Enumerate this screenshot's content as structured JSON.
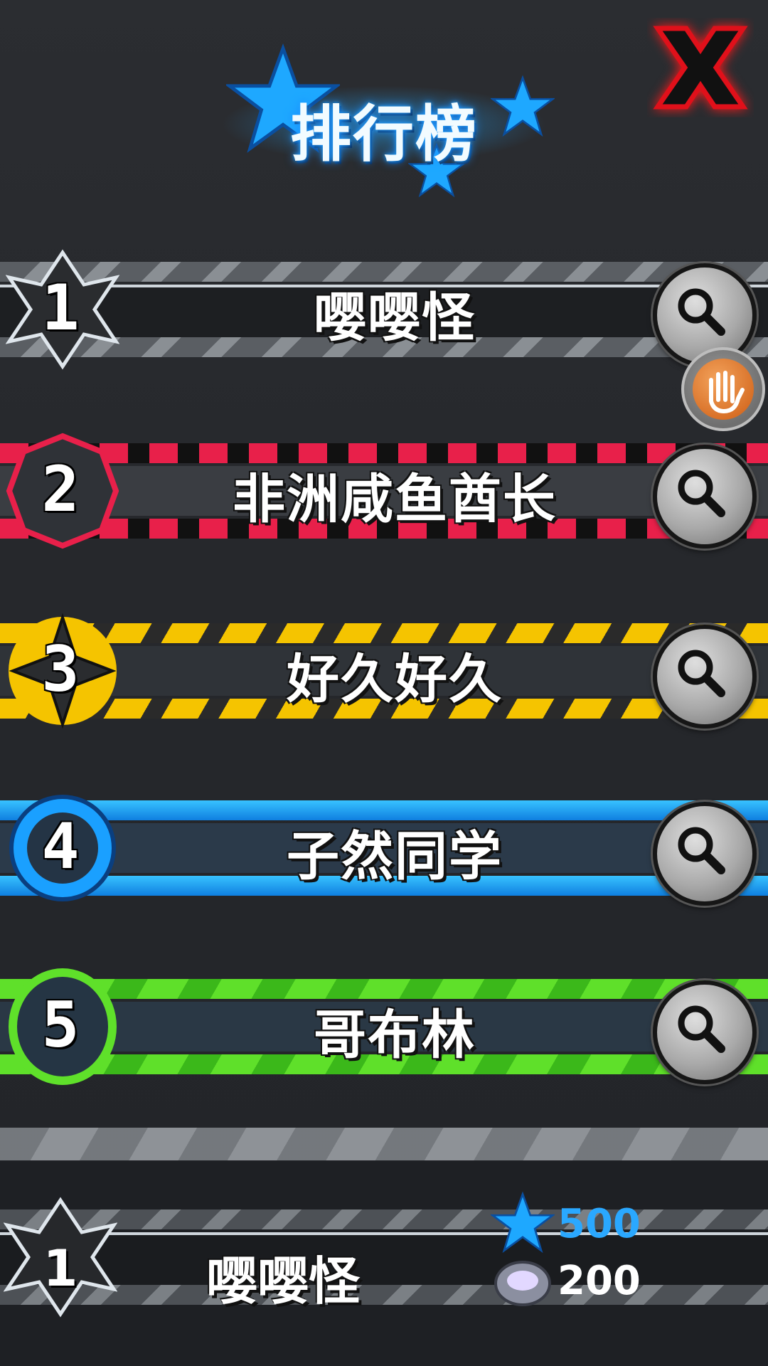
{
  "header": {
    "title": "排行榜",
    "close_icon": "close-x-icon"
  },
  "colors": {
    "rank1": "#9aa0a6",
    "rank2": "#e8204a",
    "rank3": "#f5c400",
    "rank4": "#1aa0ff",
    "rank5": "#5fe02a",
    "title_glow": "#1ea0ff",
    "star_value": "#2aa8ff"
  },
  "leaderboard": [
    {
      "rank": "1",
      "name": "嘤嘤怪",
      "theme": "silver",
      "action_icon": "search-icon"
    },
    {
      "rank": "2",
      "name": "非洲咸鱼酋长",
      "theme": "red",
      "action_icon": "search-icon"
    },
    {
      "rank": "3",
      "name": "好久好久",
      "theme": "yellow",
      "action_icon": "search-icon"
    },
    {
      "rank": "4",
      "name": "子然同学",
      "theme": "blue",
      "action_icon": "search-icon"
    },
    {
      "rank": "5",
      "name": "哥布林",
      "theme": "green",
      "action_icon": "search-icon"
    }
  ],
  "floating_button": {
    "icon": "hand-icon"
  },
  "self": {
    "rank": "1",
    "name": "嘤嘤怪",
    "stars": "500",
    "stars_icon": "star-icon",
    "gems": "200",
    "gems_icon": "crystal-icon"
  }
}
